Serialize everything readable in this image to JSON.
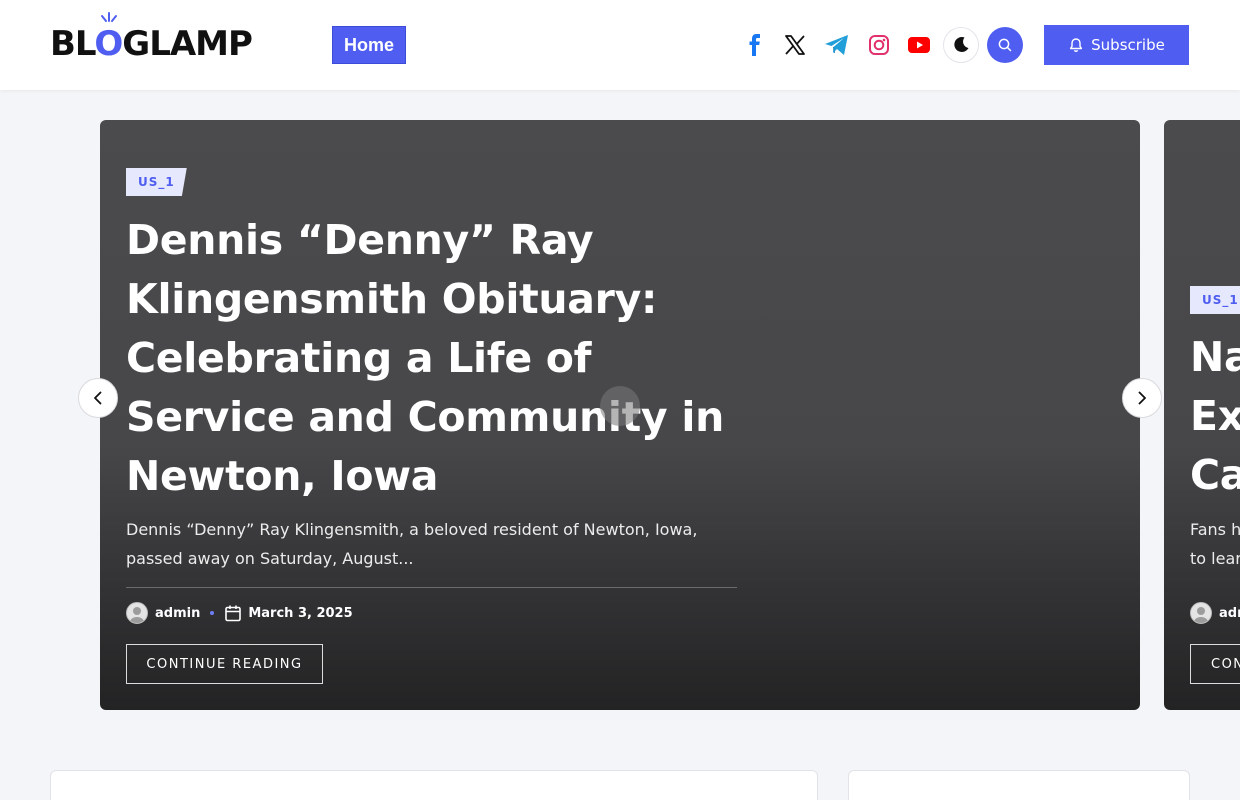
{
  "header": {
    "logo_text": "BLOGLAMP",
    "nav": {
      "home_label": "Home"
    },
    "social_icons": [
      "facebook-icon",
      "x-twitter-icon",
      "telegram-icon",
      "instagram-icon",
      "youtube-icon"
    ],
    "subscribe_label": "Subscribe"
  },
  "slider": {
    "slides": [
      {
        "category": "US_1",
        "title": "Dennis “Denny” Ray Klingensmith Obituary: Celebrating a Life of Service and Community in Newton, Iowa",
        "excerpt": "Dennis “Denny” Ray Klingensmith, a beloved resident of Newton, Iowa, passed away on Saturday, August...",
        "author": "admin",
        "date": "March 3, 2025",
        "cta_label": "CONTINUE READING"
      },
      {
        "category": "US_1",
        "title_lines": [
          "Na",
          "Ex",
          "Ca"
        ],
        "excerpt_lines": [
          "Fans h",
          "to lear"
        ],
        "author": "adm",
        "cta_label": "CON"
      }
    ]
  },
  "colors": {
    "accent": "#4f5ef0",
    "facebook": "#1877f2",
    "telegram": "#229ed9",
    "instagram": "#e1306c",
    "youtube": "#ff0000"
  }
}
